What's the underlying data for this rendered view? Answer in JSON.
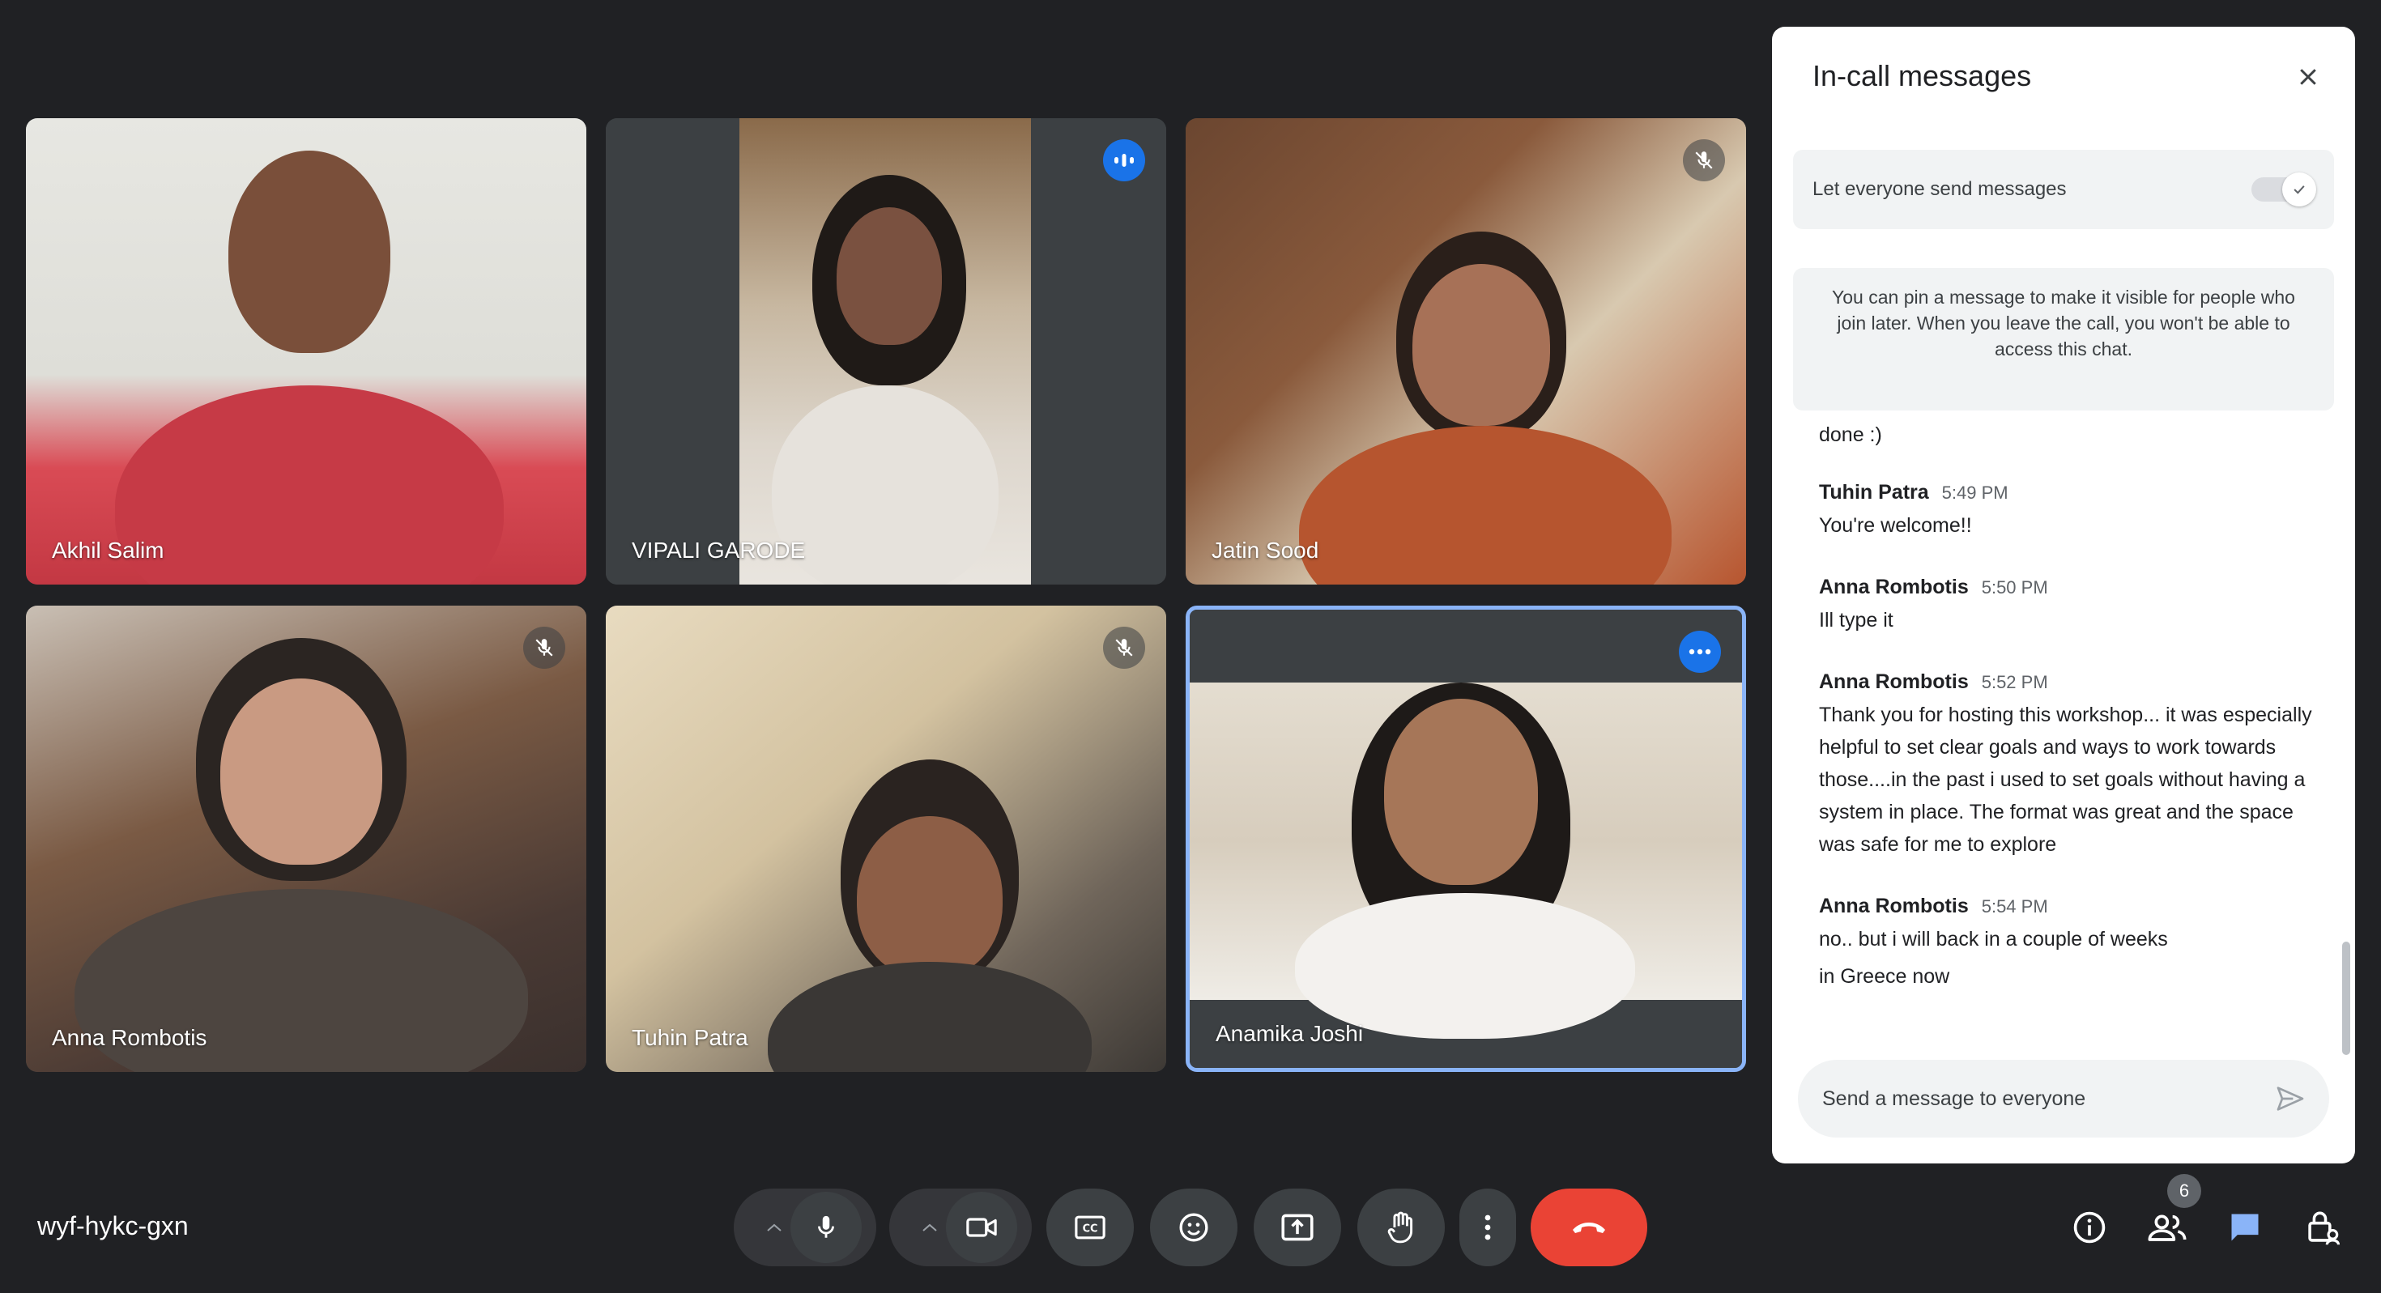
{
  "participants": [
    {
      "name": "Akhil Salim",
      "status": "none"
    },
    {
      "name": "VIPALI GARODE",
      "status": "speaking"
    },
    {
      "name": "Jatin Sood",
      "status": "muted"
    },
    {
      "name": "Anna Rombotis",
      "status": "muted"
    },
    {
      "name": "Tuhin Patra",
      "status": "muted"
    },
    {
      "name": "Anamika Joshi",
      "status": "more-options"
    }
  ],
  "panel": {
    "title": "In-call messages",
    "toggle_label": "Let everyone send messages",
    "toggle_on": true,
    "info": "You can pin a message to make it visible for people who join later. When you leave the call, you won't be able to access this chat.",
    "partial_message": "done :)",
    "messages": [
      {
        "sender": "Tuhin Patra",
        "time": "5:49 PM",
        "lines": [
          "You're welcome!!"
        ]
      },
      {
        "sender": "Anna Rombotis",
        "time": "5:50 PM",
        "lines": [
          "Ill type it"
        ]
      },
      {
        "sender": "Anna Rombotis",
        "time": "5:52 PM",
        "lines": [
          "Thank you for hosting this workshop... it was especially helpful to set clear goals and ways to work towards those....in the past i used to set goals without having a system in place. The format was great and the space was safe for me to explore"
        ]
      },
      {
        "sender": "Anna Rombotis",
        "time": "5:54 PM",
        "lines": [
          "no.. but i will back in a couple of weeks",
          "in Greece now"
        ]
      }
    ],
    "compose_placeholder": "Send a message to everyone"
  },
  "meeting_code": "wyf-hykc-gxn",
  "people_count": "6",
  "colors": {
    "accent": "#1a73e8",
    "hangup": "#ea4335",
    "background": "#202124",
    "active_border": "#8ab4f8"
  }
}
